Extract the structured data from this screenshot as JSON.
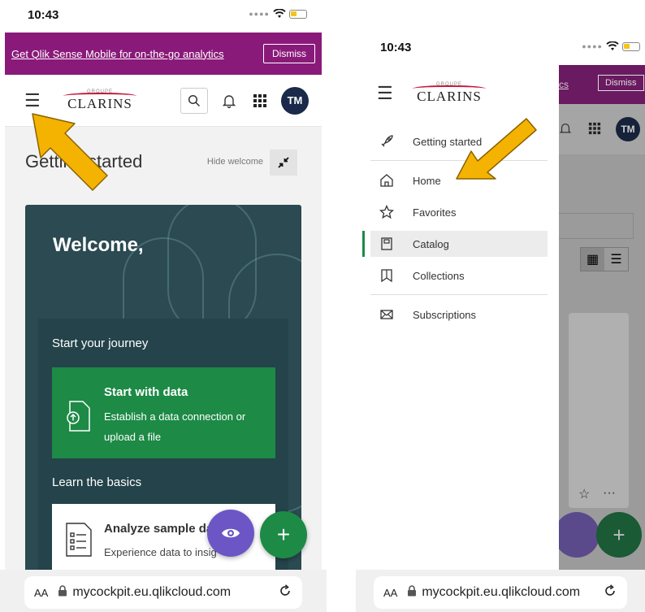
{
  "status": {
    "time": "10:43"
  },
  "banner": {
    "link": "Get Qlik Sense Mobile for on-the-go analytics",
    "dismiss": "Dismiss"
  },
  "logo": {
    "group": "GROUPE",
    "brand": "CLARINS"
  },
  "user": {
    "initials": "TM"
  },
  "welcome": {
    "title": "Getting started",
    "hide_label": "Hide welcome",
    "greeting": "Welcome,",
    "journey": "Start your journey",
    "start_title": "Start with data",
    "start_desc": "Establish a data connection or upload a file",
    "basics": "Learn the basics",
    "sample_title": "Analyze sample da",
    "sample_desc": "Experience data to insig"
  },
  "fab": {
    "add": "+"
  },
  "url": {
    "aa": "AA",
    "address": "mycockpit.eu.qlikcloud.com"
  },
  "phoneB_bg": {
    "link": "cs",
    "dismiss": "Dismiss"
  },
  "nav": {
    "items": [
      {
        "label": "Getting started",
        "icon": "rocket-icon"
      },
      {
        "label": "Home",
        "icon": "home-icon"
      },
      {
        "label": "Favorites",
        "icon": "star-icon"
      },
      {
        "label": "Catalog",
        "icon": "catalog-icon",
        "active": true
      },
      {
        "label": "Collections",
        "icon": "bookmark-icon"
      },
      {
        "label": "Subscriptions",
        "icon": "envelope-icon"
      }
    ]
  },
  "colors": {
    "banner": "#8a1a7a",
    "green": "#1d8a46",
    "purple": "#6c56c6",
    "card": "#2b4a52",
    "arrow": "#f5b301"
  }
}
